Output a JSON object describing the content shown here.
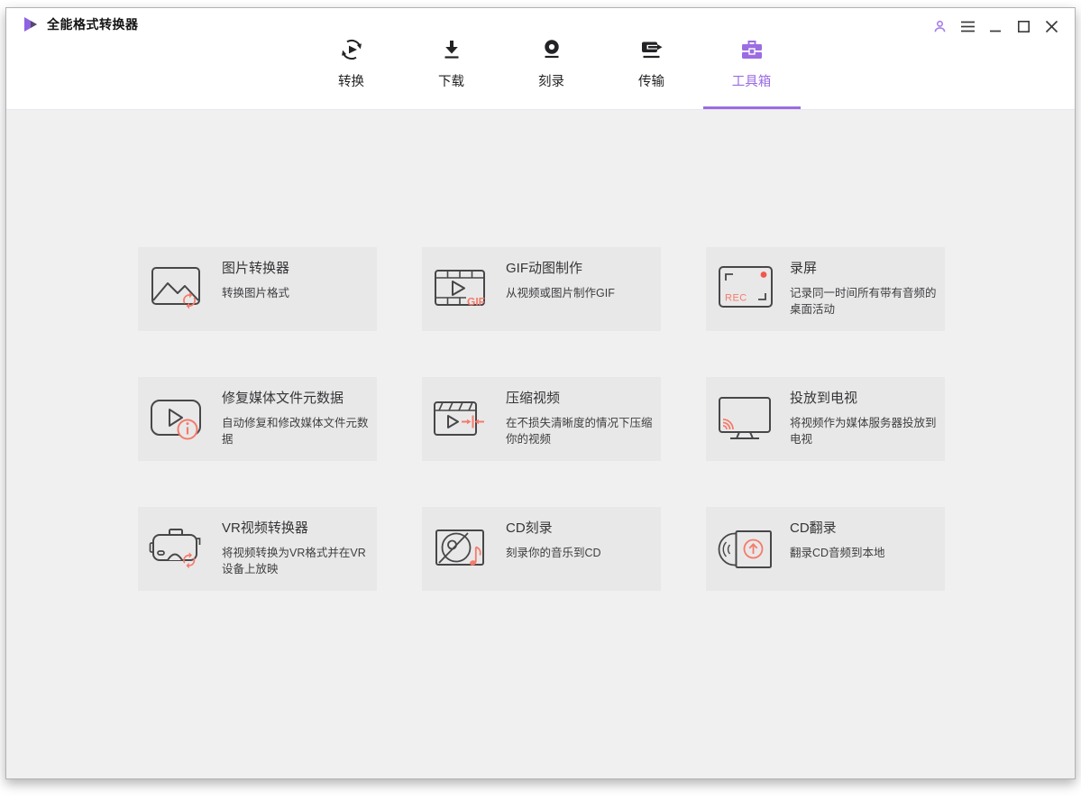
{
  "app": {
    "title": "全能格式转换器"
  },
  "titlebar": {
    "control_icons": [
      "user-icon",
      "menu-icon",
      "minimize-icon",
      "maximize-icon",
      "close-icon"
    ]
  },
  "nav": {
    "tabs": [
      {
        "id": "convert",
        "label": "转换",
        "icon": "convert-icon",
        "active": false
      },
      {
        "id": "download",
        "label": "下载",
        "icon": "download-icon",
        "active": false
      },
      {
        "id": "burn",
        "label": "刻录",
        "icon": "burn-icon",
        "active": false
      },
      {
        "id": "transfer",
        "label": "传输",
        "icon": "transfer-icon",
        "active": false
      },
      {
        "id": "toolbox",
        "label": "工具箱",
        "icon": "toolbox-icon",
        "active": true
      }
    ]
  },
  "toolbox": {
    "cards": [
      {
        "id": "image-converter",
        "title": "图片转换器",
        "desc": "转换图片格式"
      },
      {
        "id": "gif-maker",
        "title": "GIF动图制作",
        "desc": "从视频或图片制作GIF"
      },
      {
        "id": "screen-recorder",
        "title": "录屏",
        "desc": "记录同一时间所有带有音频的桌面活动"
      },
      {
        "id": "fix-metadata",
        "title": "修复媒体文件元数据",
        "desc": "自动修复和修改媒体文件元数据"
      },
      {
        "id": "compress-video",
        "title": "压缩视频",
        "desc": "在不损失清晰度的情况下压缩你的视频"
      },
      {
        "id": "cast-to-tv",
        "title": "投放到电视",
        "desc": "将视频作为媒体服务器投放到电视"
      },
      {
        "id": "vr-converter",
        "title": "VR视频转换器",
        "desc": "将视频转换为VR格式并在VR设备上放映"
      },
      {
        "id": "cd-burn",
        "title": "CD刻录",
        "desc": "刻录你的音乐到CD"
      },
      {
        "id": "cd-rip",
        "title": "CD翻录",
        "desc": "翻录CD音频到本地"
      }
    ]
  },
  "icon_labels": {
    "gif": "GIF",
    "rec": "REC"
  },
  "colors": {
    "accent": "#9c6ce2",
    "coral": "#f47b6c",
    "record_red": "#f2574b",
    "window_bg": "#f1f0f1",
    "header_bg": "#ffffff",
    "card_bg": "#e9e8e8",
    "icon_ink": "#47474a",
    "text": "#3e3e41",
    "title_ink": "#141416"
  }
}
